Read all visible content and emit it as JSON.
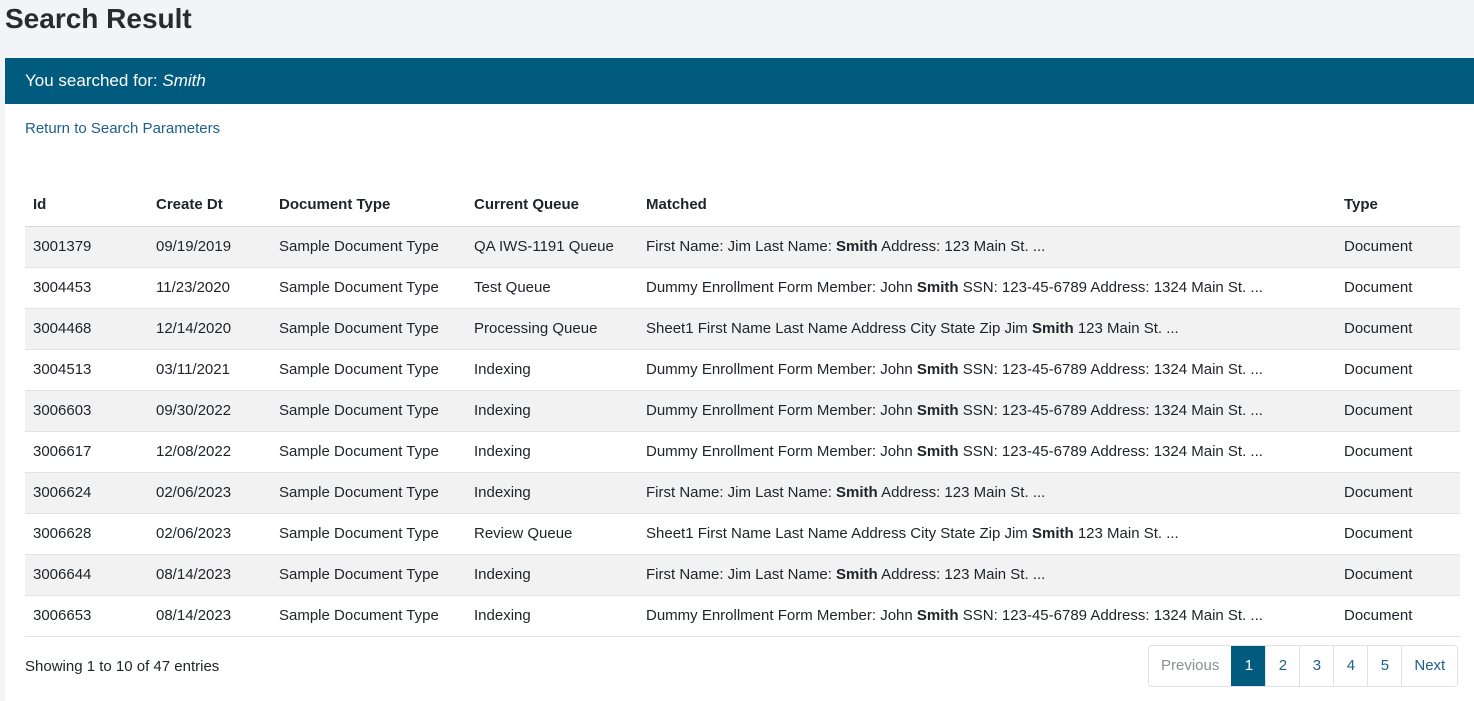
{
  "page": {
    "title": "Search Result"
  },
  "header": {
    "prefix": "You searched for:",
    "term": "Smith"
  },
  "return_link": "Return to Search Parameters",
  "table": {
    "columns": [
      "Id",
      "Create Dt",
      "Document Type",
      "Current Queue",
      "Matched",
      "Type"
    ],
    "rows": [
      {
        "id": "3001379",
        "date": "09/19/2019",
        "doctype": "Sample Document Type",
        "queue": "QA IWS-1191 Queue",
        "matched_before": "First Name: Jim Last Name:",
        "matched_term": "Smith",
        "matched_after": "Address: 123 Main St. ...",
        "type": "Document"
      },
      {
        "id": "3004453",
        "date": "11/23/2020",
        "doctype": "Sample Document Type",
        "queue": "Test Queue",
        "matched_before": "Dummy Enrollment Form Member: John",
        "matched_term": "Smith",
        "matched_after": "SSN: 123-45-6789 Address: 1324 Main St. ...",
        "type": "Document"
      },
      {
        "id": "3004468",
        "date": "12/14/2020",
        "doctype": "Sample Document Type",
        "queue": "Processing Queue",
        "matched_before": "Sheet1 First Name Last Name Address City State Zip Jim",
        "matched_term": "Smith",
        "matched_after": "123 Main St. ...",
        "type": "Document"
      },
      {
        "id": "3004513",
        "date": "03/11/2021",
        "doctype": "Sample Document Type",
        "queue": "Indexing",
        "matched_before": "Dummy Enrollment Form Member: John",
        "matched_term": "Smith",
        "matched_after": "SSN: 123-45-6789 Address: 1324 Main St. ...",
        "type": "Document"
      },
      {
        "id": "3006603",
        "date": "09/30/2022",
        "doctype": "Sample Document Type",
        "queue": "Indexing",
        "matched_before": "Dummy Enrollment Form Member: John",
        "matched_term": "Smith",
        "matched_after": "SSN: 123-45-6789 Address: 1324 Main St. ...",
        "type": "Document"
      },
      {
        "id": "3006617",
        "date": "12/08/2022",
        "doctype": "Sample Document Type",
        "queue": "Indexing",
        "matched_before": "Dummy Enrollment Form Member: John",
        "matched_term": "Smith",
        "matched_after": "SSN: 123-45-6789 Address: 1324 Main St. ...",
        "type": "Document"
      },
      {
        "id": "3006624",
        "date": "02/06/2023",
        "doctype": "Sample Document Type",
        "queue": "Indexing",
        "matched_before": "First Name: Jim Last Name:",
        "matched_term": "Smith",
        "matched_after": "Address: 123 Main St. ...",
        "type": "Document"
      },
      {
        "id": "3006628",
        "date": "02/06/2023",
        "doctype": "Sample Document Type",
        "queue": "Review Queue",
        "matched_before": "Sheet1 First Name Last Name Address City State Zip Jim",
        "matched_term": "Smith",
        "matched_after": "123 Main St. ...",
        "type": "Document"
      },
      {
        "id": "3006644",
        "date": "08/14/2023",
        "doctype": "Sample Document Type",
        "queue": "Indexing",
        "matched_before": "First Name: Jim Last Name:",
        "matched_term": "Smith",
        "matched_after": "Address: 123 Main St. ...",
        "type": "Document"
      },
      {
        "id": "3006653",
        "date": "08/14/2023",
        "doctype": "Sample Document Type",
        "queue": "Indexing",
        "matched_before": "Dummy Enrollment Form Member: John",
        "matched_term": "Smith",
        "matched_after": "SSN: 123-45-6789 Address: 1324 Main St. ...",
        "type": "Document"
      }
    ]
  },
  "footer": {
    "info": "Showing 1 to 10 of 47 entries",
    "pagination": {
      "previous": "Previous",
      "pages": [
        "1",
        "2",
        "3",
        "4",
        "5"
      ],
      "active_page": "1",
      "next": "Next"
    }
  },
  "colors": {
    "header_bg": "#005b7f",
    "link": "#1f5f8b",
    "active_page_bg": "#005b7f"
  }
}
